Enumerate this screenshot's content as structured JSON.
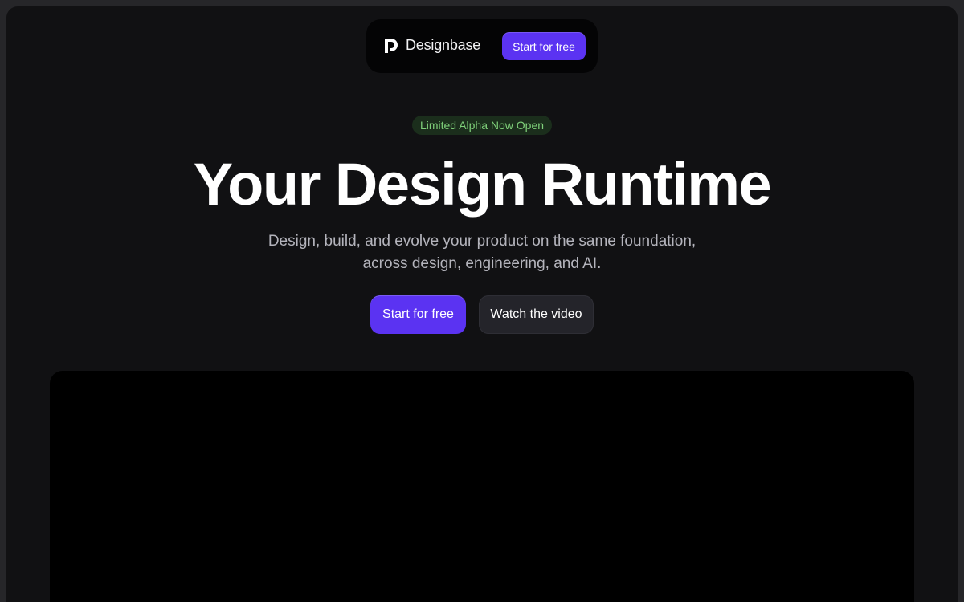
{
  "nav": {
    "brand": "Designbase",
    "cta_label": "Start for free",
    "logo_icon": "designbase-logo-icon"
  },
  "hero": {
    "badge": "Limited Alpha Now Open",
    "title": "Your Design Runtime",
    "subtitle_line1": "Design, build, and evolve your product on the same foundation,",
    "subtitle_line2": "across design, engineering, and AI.",
    "primary_cta": "Start for free",
    "secondary_cta": "Watch the video"
  },
  "colors": {
    "accent": "#5b33f2",
    "background": "#111113",
    "badge_text": "#7fd07a",
    "badge_bg": "#1b2e1c"
  }
}
